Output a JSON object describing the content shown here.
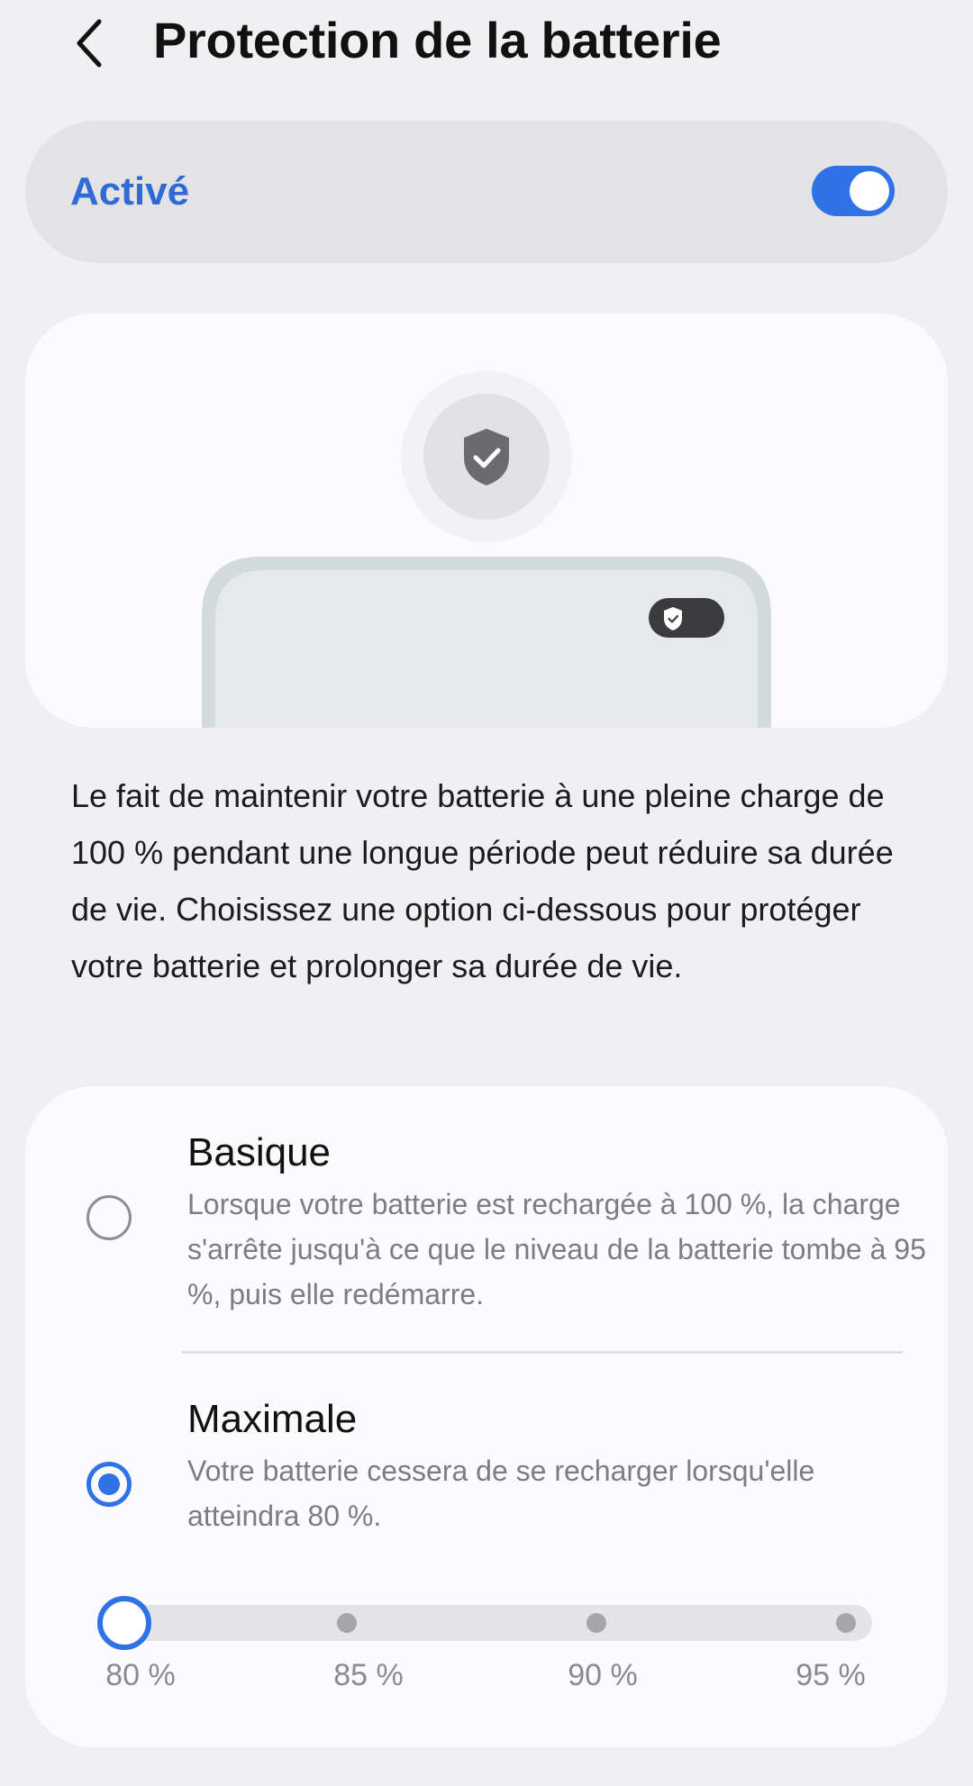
{
  "header": {
    "title": "Protection de la batterie",
    "back_icon": "chevron-left-icon"
  },
  "master_toggle": {
    "label": "Activé",
    "on": true,
    "accent": "#2f72e8",
    "label_color": "#2f6ad6"
  },
  "illustration": {
    "main_icon": "shield-check-icon",
    "badge_icon": "shield-check-icon"
  },
  "description": "Le fait de maintenir votre batterie à une pleine charge de 100 % pendant une longue période peut réduire sa durée de vie. Choisissez une option ci-dessous pour protéger votre batterie et prolonger sa durée de vie.",
  "options": [
    {
      "title": "Basique",
      "description": "Lorsque votre batterie est rechargée à 100 %, la charge s'arrête jusqu'à ce que le niveau de la batterie tombe à 95 %, puis elle redémarre.",
      "selected": false
    },
    {
      "title": "Maximale",
      "description": "Votre batterie cessera de se recharger lorsqu'elle atteindra 80 %.",
      "selected": true
    }
  ],
  "limit_slider": {
    "ticks": [
      "80 %",
      "85 %",
      "90 %",
      "95 %"
    ],
    "selected_index": 0
  }
}
